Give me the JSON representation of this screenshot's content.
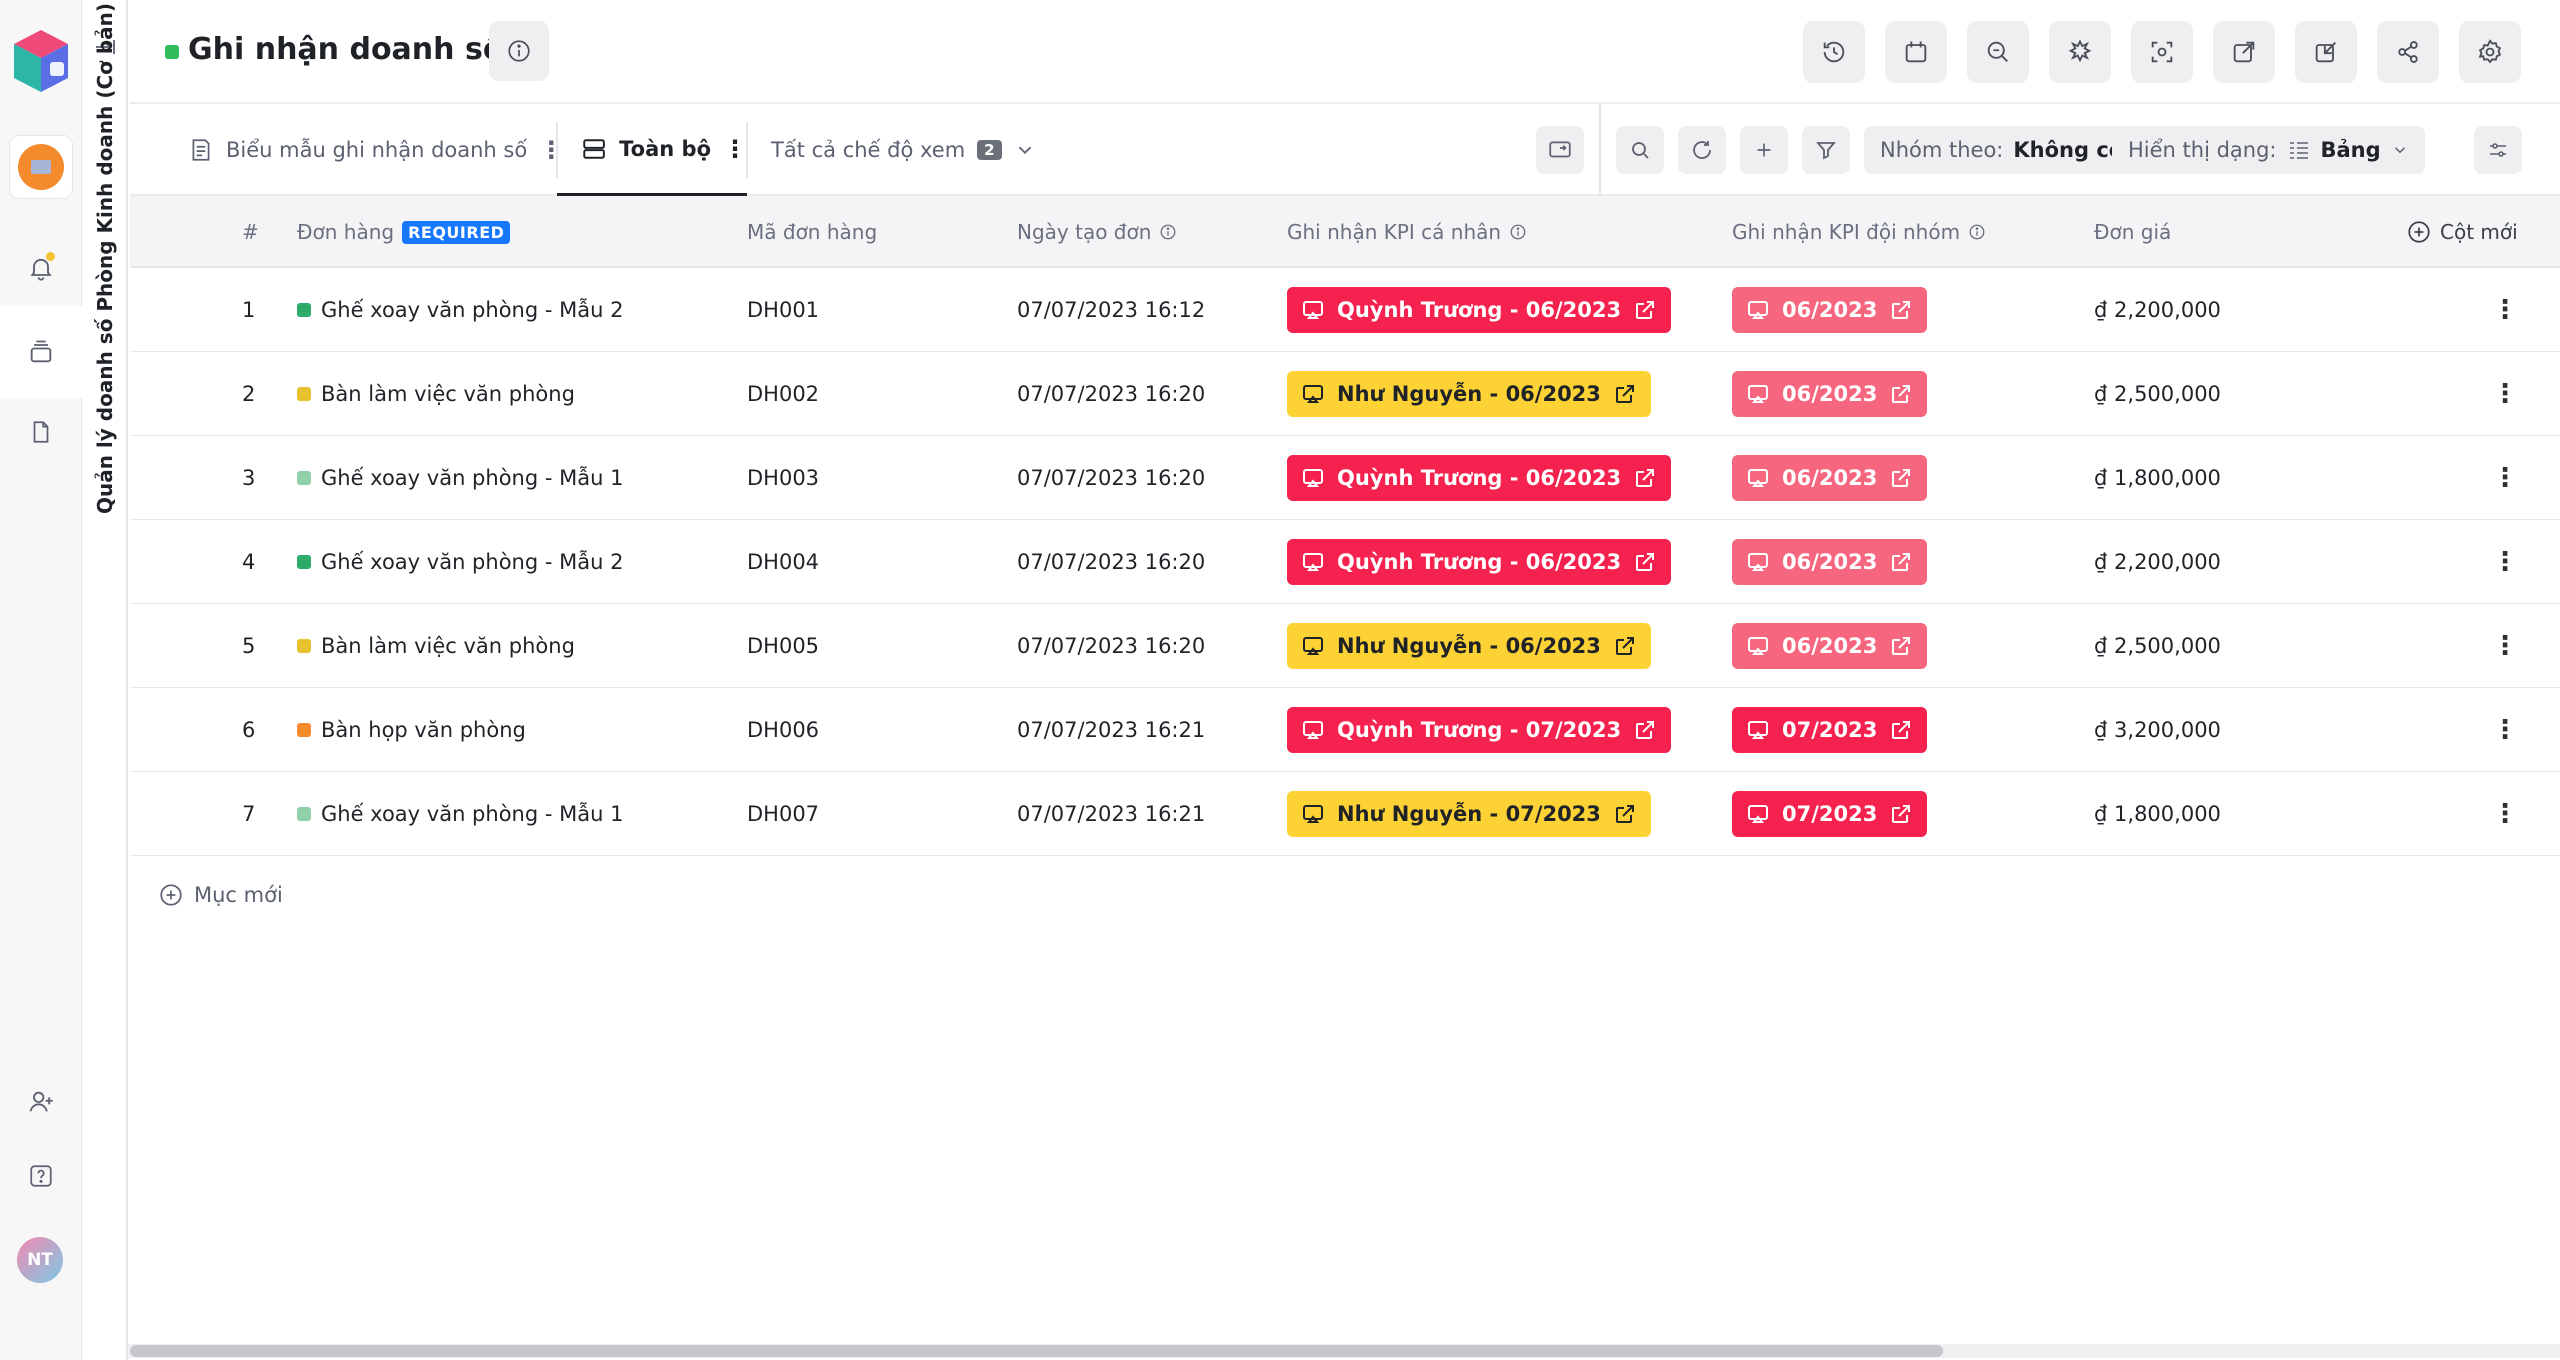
{
  "sidebar": {
    "user_initials": "NT"
  },
  "vertical_title": "Quản lý doanh số Phòng Kinh doanh (Cơ bản)",
  "header": {
    "title": "Ghi nhận doanh số",
    "status_color": "#2ebd59",
    "icons": [
      "history-icon",
      "calendar-icon",
      "zoom-icon",
      "automation-icon",
      "scan-icon",
      "export-icon",
      "import-icon",
      "share-icon",
      "settings-icon"
    ]
  },
  "toolbar": {
    "form_tab": "Biểu mẫu ghi nhận doanh số",
    "active_view": "Toàn bộ",
    "all_views": "Tất cả chế độ xem",
    "views_count": "2",
    "group_by_label": "Nhóm theo:",
    "group_by_value": "Không có",
    "display_label": "Hiển thị dạng:",
    "display_value": "Bảng"
  },
  "table": {
    "columns": {
      "index": "#",
      "order": "Đơn hàng",
      "required": "REQUIRED",
      "code": "Mã đơn hàng",
      "created": "Ngày tạo đơn",
      "kpi_personal": "Ghi nhận KPI cá nhân",
      "kpi_team": "Ghi nhận KPI đội nhóm",
      "price": "Đơn giá",
      "new_column": "Cột mới"
    },
    "rows": [
      {
        "idx": "1",
        "order": "Ghế xoay văn phòng - Mẫu 2",
        "dot": "#2eaa6a",
        "code": "DH001",
        "created": "07/07/2023 16:12",
        "kpi_personal": "Quỳnh Trương - 06/2023",
        "kpi_personal_color": "red",
        "kpi_team": "06/2023",
        "kpi_team_color": "pink",
        "price": "₫ 2,200,000"
      },
      {
        "idx": "2",
        "order": "Bàn làm việc văn phòng",
        "dot": "#e8c22f",
        "code": "DH002",
        "created": "07/07/2023 16:20",
        "kpi_personal": "Như Nguyễn - 06/2023",
        "kpi_personal_color": "yellow",
        "kpi_team": "06/2023",
        "kpi_team_color": "pink",
        "price": "₫ 2,500,000"
      },
      {
        "idx": "3",
        "order": "Ghế xoay văn phòng - Mẫu 1",
        "dot": "#8fd0a8",
        "code": "DH003",
        "created": "07/07/2023 16:20",
        "kpi_personal": "Quỳnh Trương - 06/2023",
        "kpi_personal_color": "red",
        "kpi_team": "06/2023",
        "kpi_team_color": "pink",
        "price": "₫ 1,800,000"
      },
      {
        "idx": "4",
        "order": "Ghế xoay văn phòng - Mẫu 2",
        "dot": "#2eaa6a",
        "code": "DH004",
        "created": "07/07/2023 16:20",
        "kpi_personal": "Quỳnh Trương - 06/2023",
        "kpi_personal_color": "red",
        "kpi_team": "06/2023",
        "kpi_team_color": "pink",
        "price": "₫ 2,200,000"
      },
      {
        "idx": "5",
        "order": "Bàn làm việc văn phòng",
        "dot": "#e8c22f",
        "code": "DH005",
        "created": "07/07/2023 16:20",
        "kpi_personal": "Như Nguyễn - 06/2023",
        "kpi_personal_color": "yellow",
        "kpi_team": "06/2023",
        "kpi_team_color": "pink",
        "price": "₫ 2,500,000"
      },
      {
        "idx": "6",
        "order": "Bàn họp văn phòng",
        "dot": "#f58a2c",
        "code": "DH006",
        "created": "07/07/2023 16:21",
        "kpi_personal": "Quỳnh Trương - 07/2023",
        "kpi_personal_color": "red",
        "kpi_team": "07/2023",
        "kpi_team_color": "red",
        "price": "₫ 3,200,000"
      },
      {
        "idx": "7",
        "order": "Ghế xoay văn phòng - Mẫu 1",
        "dot": "#8fd0a8",
        "code": "DH007",
        "created": "07/07/2023 16:21",
        "kpi_personal": "Như Nguyễn - 07/2023",
        "kpi_personal_color": "yellow",
        "kpi_team": "07/2023",
        "kpi_team_color": "red",
        "price": "₫ 1,800,000"
      }
    ],
    "new_item": "Mục mới"
  }
}
